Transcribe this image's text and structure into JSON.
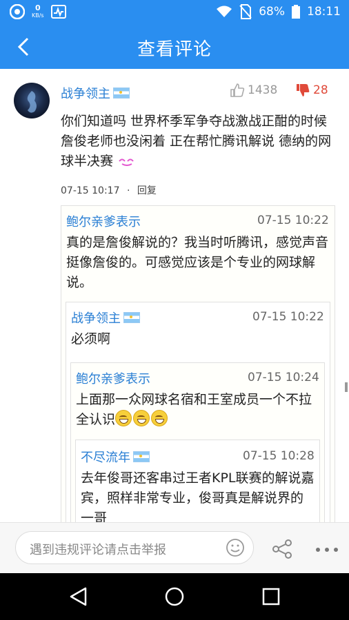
{
  "status_bar": {
    "net_speed": "0",
    "net_unit": "KB/s",
    "battery": "68%",
    "time": "18:11"
  },
  "header": {
    "title": "查看评论"
  },
  "comment": {
    "author": "战争领主",
    "likes": "1438",
    "dislikes": "28",
    "text": "你们知道吗 世界杯季军争夺战激战正酣的时候 詹俊老师也没闲着 正在帮忙腾讯解说 德纳的网球半决赛",
    "time": "07-15 10:17",
    "dot": "·",
    "reply_label": "回复"
  },
  "replies": [
    {
      "user": "鲍尔亲爹表示",
      "time": "07-15 10:22",
      "text": "真的是詹俊解说的？我当时听腾讯，感觉声音挺像詹俊的。可感觉应该是个专业的网球解说。"
    },
    {
      "user": "战争领主",
      "time": "07-15 10:22",
      "text": "必须啊"
    },
    {
      "user": "鲍尔亲爹表示",
      "time": "07-15 10:24",
      "text": "上面那一众网球名宿和王室成员一个不拉全认识"
    },
    {
      "user": "不尽流年",
      "time": "07-15 10:28",
      "text": "去年俊哥还客串过王者KPL联赛的解说嘉宾，照样非常专业，俊哥真是解说界的一哥"
    }
  ],
  "bottom_bar": {
    "placeholder": "遇到违规评论请点击举报"
  },
  "colors": {
    "brand": "#2a8ef0",
    "username": "#2a7fd4",
    "dislike": "#e04a3a"
  }
}
